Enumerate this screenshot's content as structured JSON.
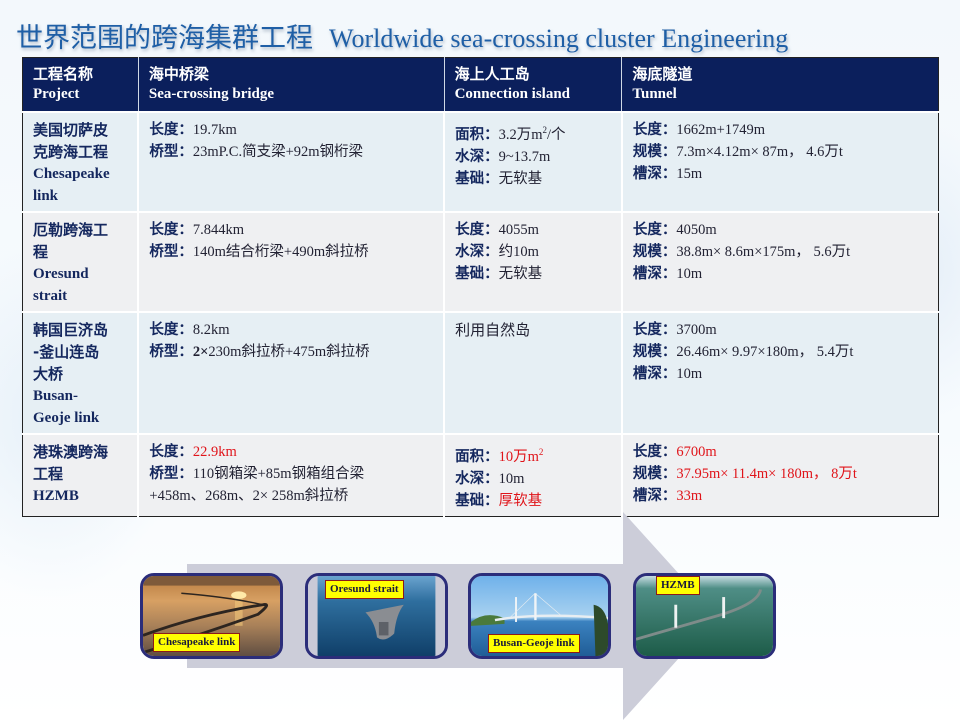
{
  "title": {
    "cn": "世界范围的跨海集群工程",
    "en": "Worldwide sea-crossing cluster Engineering"
  },
  "table": {
    "headers": [
      {
        "cn": "工程名称",
        "en": "Project"
      },
      {
        "cn": "海中桥梁",
        "en": "Sea-crossing bridge"
      },
      {
        "cn": "海上人工岛",
        "en": "Connection island"
      },
      {
        "cn": "海底隧道",
        "en": "Tunnel"
      }
    ],
    "rows": [
      {
        "project": {
          "cn_lines": [
            "美国切萨皮",
            "克跨海工程"
          ],
          "en_lines": [
            "Chesapeake",
            "link"
          ]
        },
        "bridge": [
          {
            "label": "长度：",
            "value": "19.7km"
          },
          {
            "label": "桥型：",
            "value": "23mP.C.简支梁+92m钢桁梁"
          }
        ],
        "island": [
          {
            "label": "面积：",
            "value": "3.2万m",
            "sup": "2",
            "suffix": "/个"
          },
          {
            "label": "水深：",
            "value": "9~13.7m"
          },
          {
            "label": "基础：",
            "value": "无软基"
          }
        ],
        "tunnel": [
          {
            "label": "长度：",
            "value": "1662m+1749m"
          },
          {
            "label": "规模：",
            "value": "7.3m×4.12m× 87m， 4.6万t"
          },
          {
            "label": "槽深：",
            "value": "15m"
          }
        ]
      },
      {
        "project": {
          "cn_lines": [
            "厄勒跨海工",
            "程"
          ],
          "en_lines": [
            "Oresund",
            "strait"
          ]
        },
        "bridge": [
          {
            "label": "长度：",
            "value": "7.844km"
          },
          {
            "label": "桥型：",
            "value": "140m结合桁梁+490m斜拉桥"
          }
        ],
        "island": [
          {
            "label": "长度：",
            "value": "4055m"
          },
          {
            "label": "水深：",
            "value": "约10m"
          },
          {
            "label": "基础：",
            "value": "无软基"
          }
        ],
        "tunnel": [
          {
            "label": "长度：",
            "value": "4050m"
          },
          {
            "label": "规模：",
            "value": "38.8m× 8.6m×175m， 5.6万t"
          },
          {
            "label": "槽深：",
            "value": "10m"
          }
        ]
      },
      {
        "project": {
          "cn_lines": [
            "韩国巨济岛",
            "-釜山连岛",
            "大桥"
          ],
          "en_lines": [
            "Busan-",
            "Geoje link"
          ]
        },
        "bridge": [
          {
            "label": "长度：",
            "value": "8.2km"
          },
          {
            "label": "桥型：",
            "value_bold": "2×",
            "value": "230m斜拉桥+475m斜拉桥"
          }
        ],
        "island_text": "利用自然岛",
        "tunnel": [
          {
            "label": "长度：",
            "value": "3700m"
          },
          {
            "label": "规模：",
            "value": "26.46m× 9.97×180m， 5.4万t"
          },
          {
            "label": "槽深：",
            "value": "10m"
          }
        ]
      },
      {
        "project": {
          "cn_lines": [
            "港珠澳跨海",
            "工程"
          ],
          "en_lines": [
            "HZMB"
          ]
        },
        "bridge": [
          {
            "label": "长度：",
            "value": "22.9km",
            "highlight": true
          },
          {
            "label": "桥型：",
            "value": "110钢箱梁+85m钢箱组合梁"
          },
          {
            "label": "",
            "value": "+458m、268m、2× 258m斜拉桥"
          }
        ],
        "island": [
          {
            "label": "面积：",
            "value": "10万m",
            "sup": "2",
            "highlight": true
          },
          {
            "label": "水深：",
            "value": "10m"
          },
          {
            "label": "基础：",
            "value": "厚软基",
            "highlight": true
          }
        ],
        "tunnel": [
          {
            "label": "长度：",
            "value": "6700m",
            "highlight": true
          },
          {
            "label": "规模：",
            "value": "37.95m× 11.4m× 180m， 8万t",
            "highlight": true
          },
          {
            "label": "槽深：",
            "value": "33m",
            "highlight": true
          }
        ]
      }
    ]
  },
  "photos": [
    {
      "caption": "Chesapeake link"
    },
    {
      "caption": "Oresund strait"
    },
    {
      "caption": "Busan-Geoje link"
    },
    {
      "caption": "HZMB"
    }
  ],
  "colors": {
    "title": "#1f5fa6",
    "header_bg": "#0b1f5c",
    "highlight_red": "#e0141a",
    "label_navy": "#14275e",
    "tag_yellow": "#ffff00",
    "arrow_gray": "#cccdd9"
  }
}
